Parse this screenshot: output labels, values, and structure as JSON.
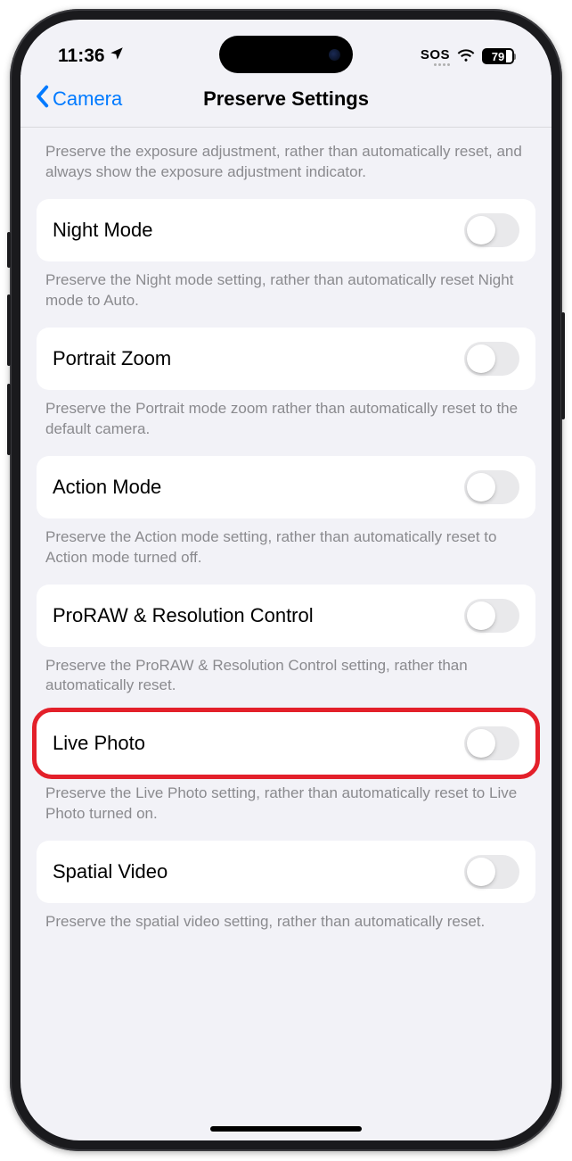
{
  "status_bar": {
    "time": "11:36",
    "sos": "SOS",
    "battery_level": "79"
  },
  "nav": {
    "back_label": "Camera",
    "title": "Preserve Settings"
  },
  "intro_footer": "Preserve the exposure adjustment, rather than automatically reset, and always show the exposure adjustment indicator.",
  "rows": {
    "night_mode": {
      "label": "Night Mode",
      "footer": "Preserve the Night mode setting, rather than automatically reset Night mode to Auto."
    },
    "portrait_zoom": {
      "label": "Portrait Zoom",
      "footer": "Preserve the Portrait mode zoom rather than automatically reset to the default camera."
    },
    "action_mode": {
      "label": "Action Mode",
      "footer": "Preserve the Action mode setting, rather than automatically reset to Action mode turned off."
    },
    "proraw": {
      "label": "ProRAW & Resolution Control",
      "footer": "Preserve the ProRAW & Resolution Control setting, rather than automatically reset."
    },
    "live_photo": {
      "label": "Live Photo",
      "footer": "Preserve the Live Photo setting, rather than automatically reset to Live Photo turned on."
    },
    "spatial_video": {
      "label": "Spatial Video",
      "footer": "Preserve the spatial video setting, rather than automatically reset."
    }
  }
}
